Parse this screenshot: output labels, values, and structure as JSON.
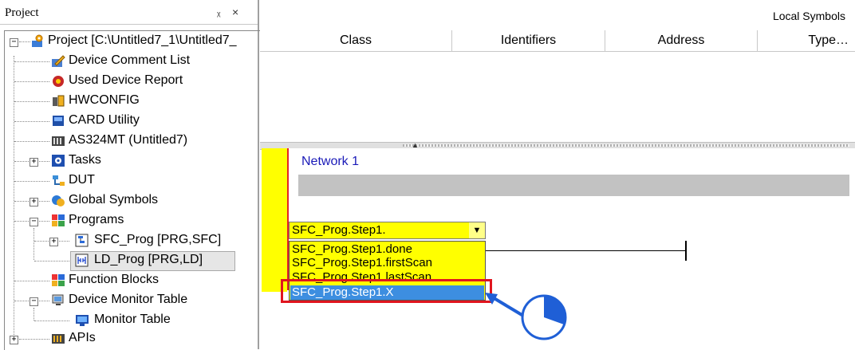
{
  "project_panel": {
    "title": "Project",
    "pin": "ᶦ",
    "close": "×",
    "tree": [
      {
        "label": "Project [C:\\Untitled7_1\\Untitled7_",
        "icon": "project-gear-icon",
        "expander": "−"
      },
      {
        "label": "Device Comment List",
        "icon": "comment-list-icon"
      },
      {
        "label": "Used Device Report",
        "icon": "device-report-icon"
      },
      {
        "label": "HWCONFIG",
        "icon": "hwconfig-icon"
      },
      {
        "label": "CARD Utility",
        "icon": "card-utility-icon"
      },
      {
        "label": "AS324MT  (Untitled7)",
        "icon": "plc-icon"
      },
      {
        "label": "Tasks",
        "icon": "tasks-icon",
        "expander": "+"
      },
      {
        "label": "DUT",
        "icon": "dut-icon"
      },
      {
        "label": "Global Symbols",
        "icon": "global-symbols-icon",
        "expander": "+"
      },
      {
        "label": "Programs",
        "icon": "programs-icon",
        "expander": "−"
      },
      {
        "label": "SFC_Prog [PRG,SFC]",
        "icon": "sfc-program-icon",
        "expander": "+"
      },
      {
        "label": "LD_Prog [PRG,LD]",
        "icon": "ld-program-icon"
      },
      {
        "label": "Function Blocks",
        "icon": "function-blocks-icon"
      },
      {
        "label": "Device Monitor Table",
        "icon": "monitor-table-group-icon",
        "expander": "−"
      },
      {
        "label": "Monitor Table",
        "icon": "monitor-table-icon"
      },
      {
        "label": "APIs",
        "icon": "apis-icon",
        "expander": "+"
      }
    ]
  },
  "symbols": {
    "title": "Local Symbols",
    "columns": [
      "Class",
      "Identifiers",
      "Address",
      "Type…"
    ]
  },
  "editor": {
    "network_label": "Network 1",
    "combo_value": "SFC_Prog.Step1.",
    "combo_arrow": "▼",
    "dropdown_items": [
      "SFC_Prog.Step1.done",
      "SFC_Prog.Step1.firstScan",
      "SFC_Prog.Step1.lastScan",
      "SFC_Prog.Step1.X"
    ],
    "selected_index": 3
  },
  "colors": {
    "accent_red": "#e0151f",
    "selection_blue": "#3d8ee0",
    "annotation_blue": "#1f5fd6",
    "editor_yellow": "#ffff00"
  }
}
